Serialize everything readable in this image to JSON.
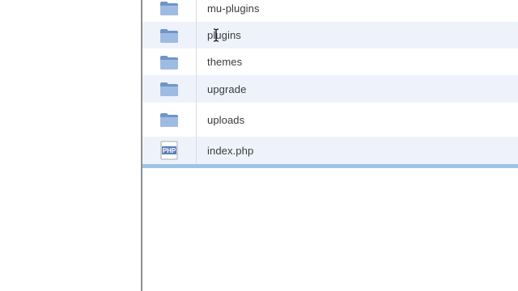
{
  "file_list": {
    "rows": [
      {
        "name": "mu-plugins",
        "icon": "folder-icon",
        "type": "folder"
      },
      {
        "name": "plugins",
        "icon": "folder-icon",
        "type": "folder"
      },
      {
        "name": "themes",
        "icon": "folder-icon",
        "type": "folder"
      },
      {
        "name": "upgrade",
        "icon": "folder-icon",
        "type": "folder"
      },
      {
        "name": "uploads",
        "icon": "folder-icon",
        "type": "folder"
      },
      {
        "name": "index.php",
        "icon": "php-file-icon",
        "type": "file",
        "icon_text": "PHP"
      }
    ]
  },
  "colors": {
    "row_alt": "#eef3fb",
    "folder_blue": "#8fb2dd",
    "selection_border": "#9fc3e6"
  }
}
